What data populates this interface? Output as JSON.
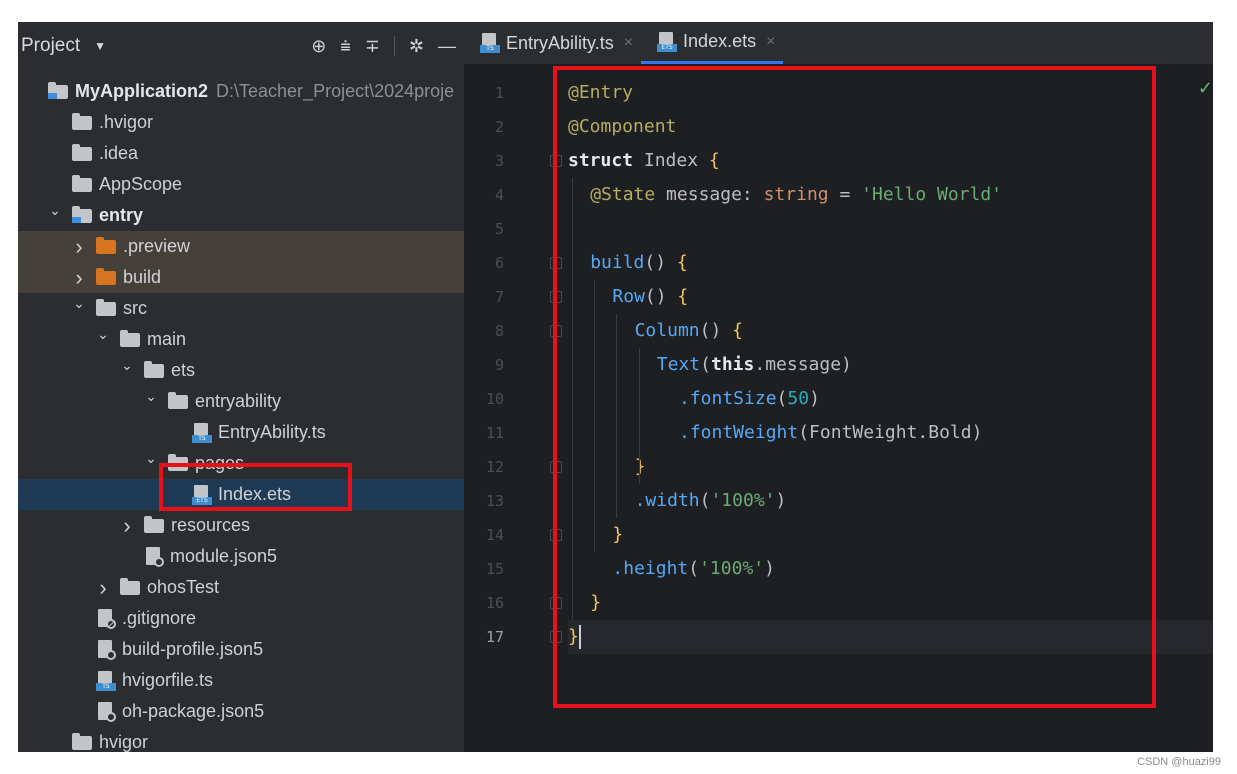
{
  "project_panel": {
    "title": "Project",
    "tool_icons": [
      "crosshair-icon",
      "collapse-all-icon",
      "expand-all-icon",
      "gear-icon",
      "minimize-icon"
    ],
    "tree": [
      {
        "label": "MyApplication2",
        "path": "D:\\Teacher_Project\\2024proje",
        "type": "module",
        "bold": true,
        "depth": 0,
        "arrow": ""
      },
      {
        "label": ".hvigor",
        "type": "folder",
        "depth": 1,
        "arrow": ""
      },
      {
        "label": ".idea",
        "type": "folder",
        "depth": 1,
        "arrow": ""
      },
      {
        "label": "AppScope",
        "type": "folder",
        "depth": 1,
        "arrow": ""
      },
      {
        "label": "entry",
        "type": "module",
        "bold": true,
        "depth": 1,
        "arrow": "expanded"
      },
      {
        "label": ".preview",
        "type": "folder-orange",
        "depth": 2,
        "arrow": "collapsed",
        "highlight": "brown"
      },
      {
        "label": "build",
        "type": "folder-orange",
        "depth": 2,
        "arrow": "collapsed",
        "highlight": "brown"
      },
      {
        "label": "src",
        "type": "folder",
        "depth": 2,
        "arrow": "expanded"
      },
      {
        "label": "main",
        "type": "folder",
        "depth": 3,
        "arrow": "expanded"
      },
      {
        "label": "ets",
        "type": "folder",
        "depth": 4,
        "arrow": "expanded"
      },
      {
        "label": "entryability",
        "type": "folder",
        "depth": 5,
        "arrow": "expanded"
      },
      {
        "label": "EntryAbility.ts",
        "type": "ts",
        "depth": 6,
        "arrow": ""
      },
      {
        "label": "pages",
        "type": "folder",
        "depth": 5,
        "arrow": "expanded"
      },
      {
        "label": "Index.ets",
        "type": "ets",
        "depth": 6,
        "arrow": "",
        "selected": true
      },
      {
        "label": "resources",
        "type": "folder",
        "depth": 4,
        "arrow": "collapsed"
      },
      {
        "label": "module.json5",
        "type": "json",
        "depth": 4,
        "arrow": ""
      },
      {
        "label": "ohosTest",
        "type": "folder",
        "depth": 3,
        "arrow": "collapsed"
      },
      {
        "label": ".gitignore",
        "type": "ignore",
        "depth": 2,
        "arrow": ""
      },
      {
        "label": "build-profile.json5",
        "type": "json",
        "depth": 2,
        "arrow": ""
      },
      {
        "label": "hvigorfile.ts",
        "type": "ts",
        "depth": 2,
        "arrow": ""
      },
      {
        "label": "oh-package.json5",
        "type": "json",
        "depth": 2,
        "arrow": ""
      },
      {
        "label": "hvigor",
        "type": "folder",
        "depth": 1,
        "arrow": ""
      }
    ]
  },
  "editor": {
    "tabs": [
      {
        "label": "EntryAbility.ts",
        "icon_tag": "TS",
        "active": false
      },
      {
        "label": "Index.ets",
        "icon_tag": "ETS",
        "active": true
      }
    ],
    "current_line": 17,
    "lines": [
      {
        "n": "1",
        "indent": 0,
        "tokens": [
          {
            "t": "@Entry",
            "c": "ann"
          }
        ]
      },
      {
        "n": "2",
        "indent": 0,
        "tokens": [
          {
            "t": "@Component",
            "c": "ann"
          }
        ]
      },
      {
        "n": "3",
        "indent": 0,
        "tokens": [
          {
            "t": "struct",
            "c": "kw bold-w"
          },
          {
            "t": " Index ",
            "c": "type"
          },
          {
            "t": "{",
            "c": "brace"
          }
        ]
      },
      {
        "n": "4",
        "indent": 1,
        "tokens": [
          {
            "t": "@State",
            "c": "ann"
          },
          {
            "t": " message: ",
            "c": "ident"
          },
          {
            "t": "string",
            "c": "kw"
          },
          {
            "t": " = ",
            "c": "ident"
          },
          {
            "t": "'Hello World'",
            "c": "str"
          }
        ]
      },
      {
        "n": "5",
        "indent": 0,
        "tokens": []
      },
      {
        "n": "6",
        "indent": 1,
        "tokens": [
          {
            "t": "build",
            "c": "fn"
          },
          {
            "t": "() ",
            "c": "ident"
          },
          {
            "t": "{",
            "c": "brace"
          }
        ]
      },
      {
        "n": "7",
        "indent": 2,
        "tokens": [
          {
            "t": "Row",
            "c": "fn"
          },
          {
            "t": "() ",
            "c": "ident"
          },
          {
            "t": "{",
            "c": "brace"
          }
        ]
      },
      {
        "n": "8",
        "indent": 3,
        "tokens": [
          {
            "t": "Column",
            "c": "fn"
          },
          {
            "t": "() ",
            "c": "ident"
          },
          {
            "t": "{",
            "c": "brace"
          }
        ]
      },
      {
        "n": "9",
        "indent": 4,
        "tokens": [
          {
            "t": "Text",
            "c": "fn"
          },
          {
            "t": "(",
            "c": "ident"
          },
          {
            "t": "this",
            "c": "kw bold-w"
          },
          {
            "t": ".message)",
            "c": "ident"
          }
        ]
      },
      {
        "n": "10",
        "indent": 5,
        "tokens": [
          {
            "t": ".fontSize",
            "c": "fn"
          },
          {
            "t": "(",
            "c": "ident"
          },
          {
            "t": "50",
            "c": "num"
          },
          {
            "t": ")",
            "c": "ident"
          }
        ]
      },
      {
        "n": "11",
        "indent": 5,
        "tokens": [
          {
            "t": ".fontWeight",
            "c": "fn"
          },
          {
            "t": "(FontWeight.Bold)",
            "c": "ident"
          }
        ]
      },
      {
        "n": "12",
        "indent": 3,
        "tokens": [
          {
            "t": "}",
            "c": "brace"
          }
        ]
      },
      {
        "n": "13",
        "indent": 3,
        "tokens": [
          {
            "t": ".width",
            "c": "fn"
          },
          {
            "t": "(",
            "c": "ident"
          },
          {
            "t": "'100%'",
            "c": "str"
          },
          {
            "t": ")",
            "c": "ident"
          }
        ]
      },
      {
        "n": "14",
        "indent": 2,
        "tokens": [
          {
            "t": "}",
            "c": "brace"
          }
        ]
      },
      {
        "n": "15",
        "indent": 2,
        "tokens": [
          {
            "t": ".height",
            "c": "fn"
          },
          {
            "t": "(",
            "c": "ident"
          },
          {
            "t": "'100%'",
            "c": "str"
          },
          {
            "t": ")",
            "c": "ident"
          }
        ]
      },
      {
        "n": "16",
        "indent": 1,
        "tokens": [
          {
            "t": "}",
            "c": "brace"
          }
        ]
      },
      {
        "n": "17",
        "indent": 0,
        "tokens": [
          {
            "t": "}",
            "c": "brace"
          }
        ]
      }
    ]
  },
  "watermark": "CSDN @huazi99",
  "colors": {
    "highlight_box": "#e8101b",
    "selection": "#1e3a55"
  }
}
